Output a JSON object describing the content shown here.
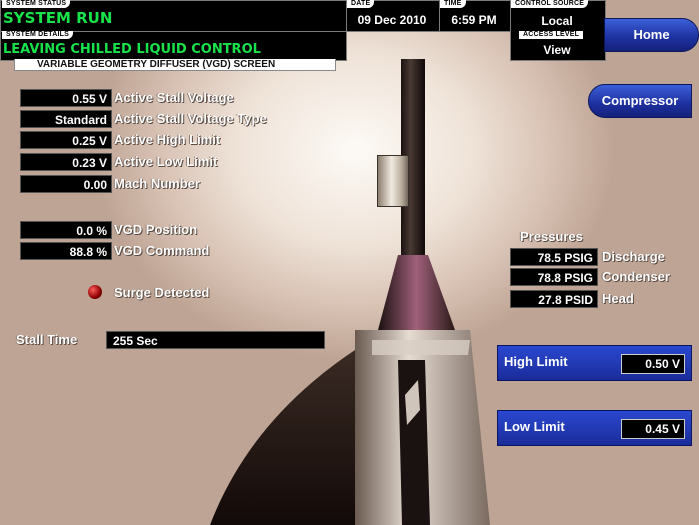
{
  "header": {
    "system_status_label": "SYSTEM STATUS",
    "system_status": "SYSTEM RUN",
    "system_details_label": "SYSTEM DETAILS",
    "system_details": "LEAVING CHILLED LIQUID CONTROL",
    "date_label": "DATE",
    "date": "09 Dec 2010",
    "time_label": "TIME",
    "time": "6:59 PM",
    "control_source_label": "CONTROL SOURCE",
    "control_source": "Local",
    "access_level_label": "ACCESS LEVEL",
    "access_level": "View",
    "screen_title": "VARIABLE GEOMETRY DIFFUSER (VGD) SCREEN"
  },
  "nav": {
    "home": "Home",
    "compressor": "Compressor"
  },
  "readouts": [
    {
      "value": "0.55 V",
      "label": "Active Stall Voltage"
    },
    {
      "value": "Standard",
      "label": "Active Stall Voltage Type"
    },
    {
      "value": "0.25 V",
      "label": "Active High Limit"
    },
    {
      "value": "0.23 V",
      "label": "Active Low Limit"
    },
    {
      "value": "0.00",
      "label": "Mach Number"
    }
  ],
  "vgd": [
    {
      "value": "0.0 %",
      "label": "VGD Position"
    },
    {
      "value": "88.8 %",
      "label": "VGD Command"
    }
  ],
  "surge": {
    "label": "Surge Detected",
    "color": "#8a0000"
  },
  "stall_time": {
    "label": "Stall Time",
    "value": "255 Sec"
  },
  "pressures": {
    "title": "Pressures",
    "rows": [
      {
        "value": "78.5 PSIG",
        "label": "Discharge"
      },
      {
        "value": "78.8 PSIG",
        "label": "Condenser"
      },
      {
        "value": "27.8 PSID",
        "label": "Head"
      }
    ]
  },
  "high_limit": {
    "label": "High Limit",
    "value": "0.50 V"
  },
  "low_limit": {
    "label": "Low Limit",
    "value": "0.45 V"
  }
}
